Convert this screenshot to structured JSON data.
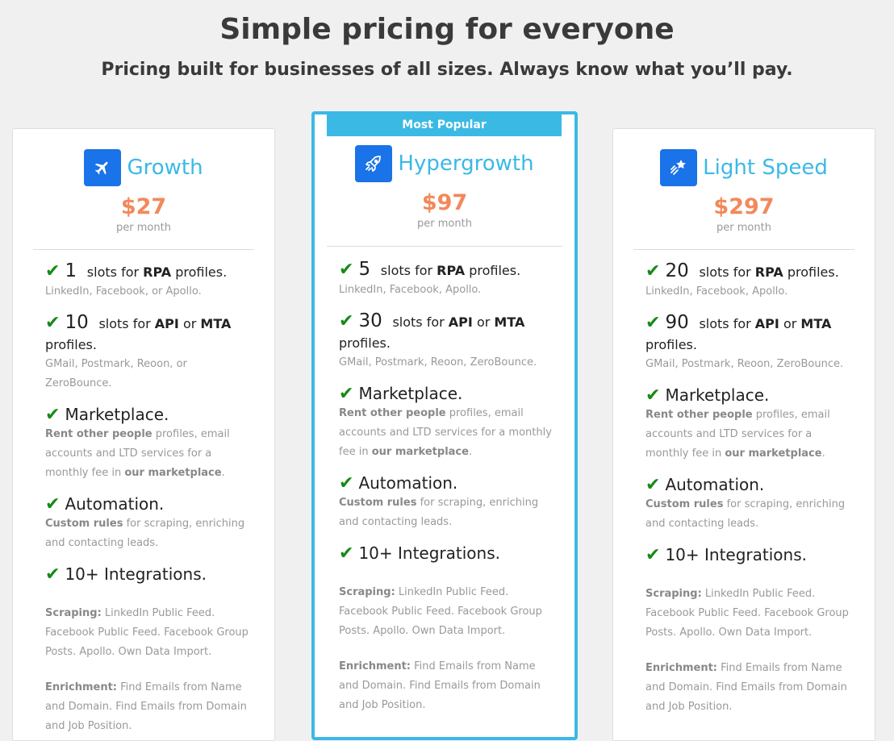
{
  "header": {
    "title": "Simple pricing for everyone",
    "subtitle": "Pricing built for businesses of all sizes. Always know what you’ll pay."
  },
  "colors": {
    "accent": "#3bb9e5",
    "price": "#f2895b",
    "icon_bg": "#1a73e8",
    "check": "#168a16"
  },
  "plans": [
    {
      "name": "Growth",
      "icon": "airplane-icon",
      "price": "$27",
      "period": "per month",
      "rpa_count": "1",
      "rpa_pre": "slots for ",
      "rpa_bold": "RPA",
      "rpa_post": " profiles.",
      "rpa_desc": "LinkedIn, Facebook, or Apollo.",
      "api_count": "10",
      "api_pre": "slots for ",
      "api_bold1": "API",
      "api_mid": " or ",
      "api_bold2": "MTA",
      "api_post": "profiles.",
      "api_desc": "GMail, Postmark, Reoon, or ZeroBounce."
    },
    {
      "name": "Hypergrowth",
      "icon": "rocket-icon",
      "price": "$97",
      "period": "per month",
      "badge": "Most Popular",
      "rpa_count": "5",
      "rpa_pre": "slots for ",
      "rpa_bold": "RPA",
      "rpa_post": " profiles.",
      "rpa_desc": "LinkedIn, Facebook, Apollo.",
      "api_count": "30",
      "api_pre": "slots for ",
      "api_bold1": "API",
      "api_mid": " or ",
      "api_bold2": "MTA",
      "api_post": "profiles.",
      "api_desc": "GMail, Postmark, Reoon, ZeroBounce."
    },
    {
      "name": "Light Speed",
      "icon": "shooting-star-icon",
      "price": "$297",
      "period": "per month",
      "rpa_count": "20",
      "rpa_pre": "slots for ",
      "rpa_bold": "RPA",
      "rpa_post": " profiles.",
      "rpa_desc": "LinkedIn, Facebook, Apollo.",
      "api_count": "90",
      "api_pre": "slots for ",
      "api_bold1": "API",
      "api_mid": " or ",
      "api_bold2": "MTA",
      "api_post": "profiles.",
      "api_desc": "GMail, Postmark, Reoon, ZeroBounce."
    }
  ],
  "common": {
    "marketplace_title": "Marketplace.",
    "marketplace_b1": "Rent other people",
    "marketplace_t1": " profiles, email accounts and LTD services for a monthly fee in ",
    "marketplace_b2": "our marketplace",
    "marketplace_t2": ".",
    "automation_title": "Automation.",
    "automation_b": "Custom rules",
    "automation_t": " for scraping, enriching and contacting leads.",
    "integrations_title": "10+ Integrations.",
    "scraping_label": "Scraping:",
    "scraping_text": " LinkedIn Public Feed. Facebook Public Feed. Facebook Group Posts. Apollo. Own Data Import.",
    "enrichment_label": "Enrichment:",
    "enrichment_text": " Find Emails from Name and Domain. Find Emails from Domain and Job Position."
  }
}
